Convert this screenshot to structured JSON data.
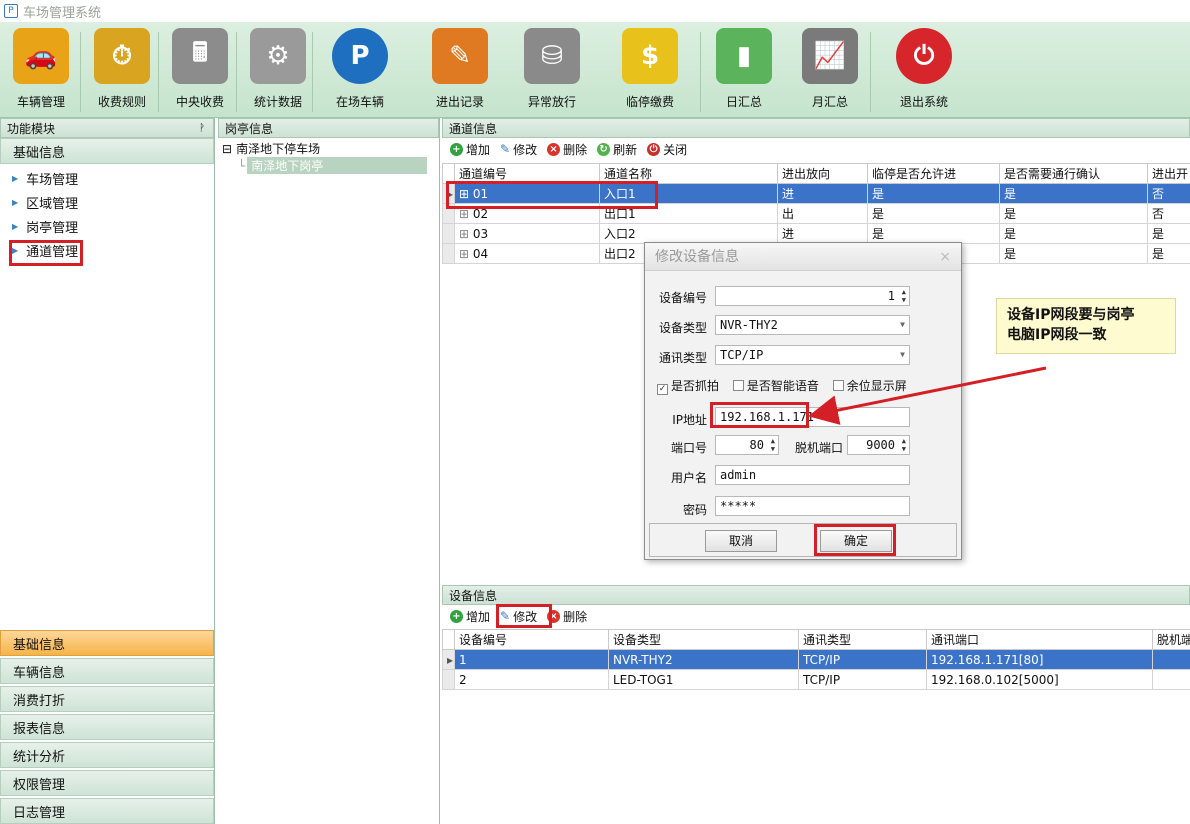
{
  "window": {
    "title": "车场管理系统"
  },
  "toolbar": [
    {
      "label": "车辆管理",
      "icon": "sports-car-icon",
      "color": "#e8a317"
    },
    {
      "label": "收费规则",
      "icon": "coins-clock-icon",
      "color": "#d9a520"
    },
    {
      "label": "中央收费",
      "icon": "cash-register-icon",
      "color": "#8c8c8c"
    },
    {
      "label": "统计数据",
      "icon": "gear-document-icon",
      "color": "#9a9a9a"
    },
    {
      "label": "在场车辆",
      "icon": "parking-car-icon",
      "color": "#1f6fc0"
    },
    {
      "label": "进出记录",
      "icon": "pencil-note-icon",
      "color": "#e07a22"
    },
    {
      "label": "异常放行",
      "icon": "database-error-icon",
      "color": "#8a8a8a"
    },
    {
      "label": "临停缴费",
      "icon": "dollar-coin-icon",
      "color": "#e8c21a"
    },
    {
      "label": "日汇总",
      "icon": "bar-chart-icon",
      "color": "#5bb35b"
    },
    {
      "label": "月汇总",
      "icon": "line-chart-icon",
      "color": "#7a7a7a"
    },
    {
      "label": "退出系统",
      "icon": "power-icon",
      "color": "#d6262b"
    }
  ],
  "left": {
    "header": "功能模块",
    "pin": "ᚹ",
    "group_top": "基础信息",
    "items": [
      "车场管理",
      "区域管理",
      "岗亭管理",
      "通道管理"
    ],
    "groups_bottom": [
      "基础信息",
      "车辆信息",
      "消费打折",
      "报表信息",
      "统计分析",
      "权限管理",
      "日志管理"
    ]
  },
  "booth": {
    "header": "岗亭信息",
    "tree_root": "南泽地下停车场",
    "tree_child": "南泽地下岗亭",
    "collapse": "⊟"
  },
  "channels": {
    "header": "通道信息",
    "buttons": {
      "add": "增加",
      "edit": "修改",
      "delete": "删除",
      "refresh": "刷新",
      "close": "关闭"
    },
    "columns": [
      "通道编号",
      "通道名称",
      "进出放向",
      "临停是否允许进",
      "是否需要通行确认",
      "进出开"
    ],
    "rows": [
      [
        "01",
        "入口1",
        "进",
        "是",
        "是",
        "否"
      ],
      [
        "02",
        "出口1",
        "出",
        "是",
        "是",
        "否"
      ],
      [
        "03",
        "入口2",
        "进",
        "是",
        "是",
        "是"
      ],
      [
        "04",
        "出口2",
        "",
        "",
        "是",
        "是"
      ]
    ]
  },
  "devices": {
    "header": "设备信息",
    "buttons": {
      "add": "增加",
      "edit": "修改",
      "delete": "删除"
    },
    "columns": [
      "设备编号",
      "设备类型",
      "通讯类型",
      "通讯端口",
      "脱机端"
    ],
    "rows": [
      [
        "1",
        "NVR-THY2",
        "TCP/IP",
        "192.168.1.171[80]",
        ""
      ],
      [
        "2",
        "LED-TOG1",
        "TCP/IP",
        "192.168.0.102[5000]",
        ""
      ]
    ]
  },
  "dialog": {
    "title": "修改设备信息",
    "close": "×",
    "device_no_label": "设备编号",
    "device_no": "1",
    "device_type_label": "设备类型",
    "device_type": "NVR-THY2",
    "comm_type_label": "通讯类型",
    "comm_type": "TCP/IP",
    "chk_capture": "是否抓拍",
    "chk_voice": "是否智能语音",
    "chk_screen": "余位显示屏",
    "ip_label": "IP地址",
    "ip": "192.168.1.171",
    "port_label": "端口号",
    "port": "80",
    "offline_port_label": "脱机端口",
    "offline_port": "9000",
    "user_label": "用户名",
    "user": "admin",
    "pwd_label": "密码",
    "pwd": "*****",
    "cancel": "取消",
    "ok": "确定"
  },
  "callout": {
    "line1": "设备IP网段要与岗亭",
    "line2": "电脑IP网段一致"
  },
  "colors": {
    "highlight": "#d51f26",
    "selection": "#3b73c9",
    "panel": "#cde1d3"
  }
}
